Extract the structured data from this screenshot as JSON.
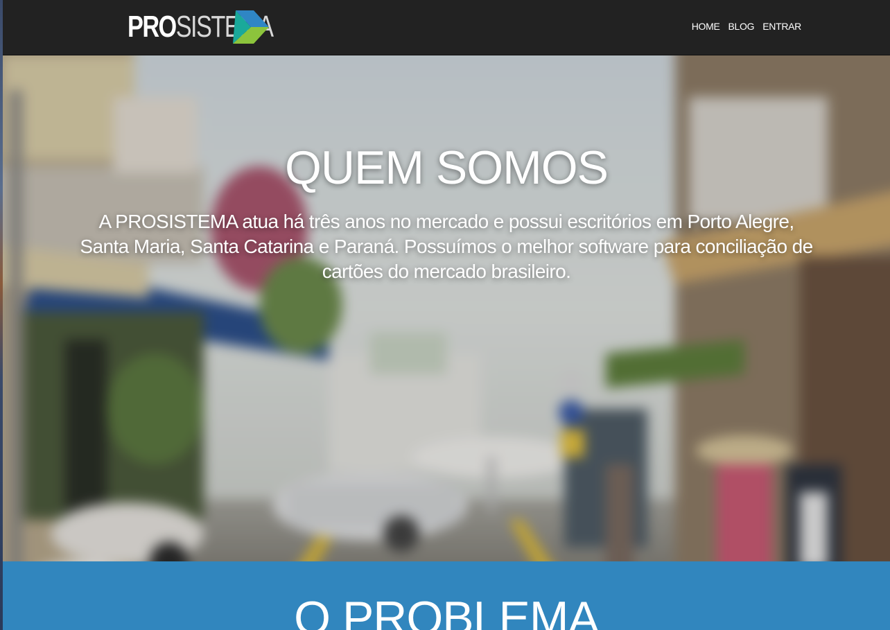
{
  "brand": {
    "logo_bold": "PRO",
    "logo_light": "SISTEMA",
    "logo_icon": "triangle-arrow-icon",
    "colors": {
      "blue": "#2f86c4",
      "teal": "#1aa99a",
      "green": "#8cc43c",
      "navbar": "#222222",
      "section_blue": "#3186be"
    }
  },
  "nav": {
    "items": [
      {
        "label": "HOME"
      },
      {
        "label": "BLOG"
      },
      {
        "label": "ENTRAR"
      }
    ]
  },
  "hero": {
    "title": "QUEM SOMOS",
    "text": "A PROSISTEMA atua há três anos no mercado e possui escritórios em Porto Alegre, Santa Maria, Santa Catarina e Paraná. Possuímos o melhor software para conciliação de cartões do mercado brasileiro."
  },
  "problem": {
    "title": "O PROBLEMA"
  }
}
